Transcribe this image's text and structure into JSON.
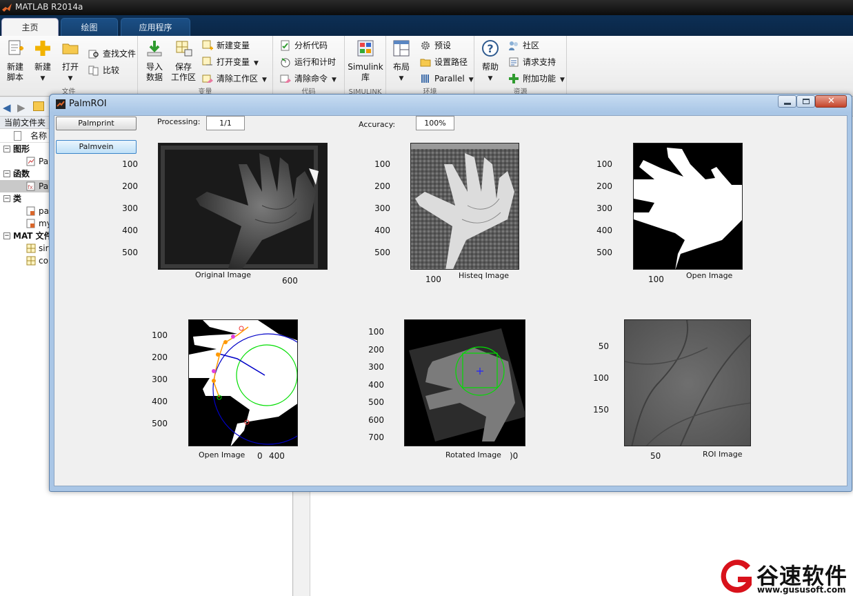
{
  "app": {
    "title": "MATLAB R2014a",
    "tabs": [
      "主页",
      "绘图",
      "应用程序"
    ],
    "active_tab": 0
  },
  "ribbon": {
    "new_script": "新建\n脚本",
    "new": "新建",
    "open": "打开",
    "find_files": "查找文件",
    "compare": "比较",
    "import_data": "导入\n数据",
    "save_workspace": "保存\n工作区",
    "new_variable": "新建变量",
    "open_variable": "打开变量",
    "clear_workspace": "清除工作区",
    "analyze_code": "分析代码",
    "run_and_time": "运行和计时",
    "clear_commands": "清除命令",
    "simulink": "Simulink\n库",
    "layout": "布局",
    "preferences": "预设",
    "set_path": "设置路径",
    "parallel": "Parallel",
    "help": "帮助",
    "community": "社区",
    "request_support": "请求支持",
    "addons": "附加功能",
    "group_labels": [
      "文件",
      "变量",
      "代码",
      "SIMULINK",
      "环境",
      "资源"
    ]
  },
  "current_folder": {
    "header": "当前文件夹",
    "column_name": "名称",
    "items": [
      {
        "label": "图形",
        "kind": "group"
      },
      {
        "label": "Pa",
        "kind": "fig"
      },
      {
        "label": "函数",
        "kind": "group"
      },
      {
        "label": "Pa",
        "kind": "func",
        "selected": true
      },
      {
        "label": "类",
        "kind": "group"
      },
      {
        "label": "pa",
        "kind": "class"
      },
      {
        "label": "my",
        "kind": "class"
      },
      {
        "label": "MAT 文件",
        "kind": "group"
      },
      {
        "label": "sir",
        "kind": "mat"
      },
      {
        "label": "co",
        "kind": "mat"
      }
    ]
  },
  "figure": {
    "title": "PalmROI",
    "buttons": {
      "palmprint": "Palmprint",
      "palmvein": "Palmvein"
    },
    "processing_label": "Processing:",
    "processing_value": "1/1",
    "accuracy_label": "Accuracy:",
    "accuracy_value": "100%",
    "axes": [
      {
        "label": "Original Image",
        "yticks": [
          "100",
          "200",
          "300",
          "400",
          "500"
        ],
        "xticks": [
          "600"
        ]
      },
      {
        "label": "Histeq Image",
        "yticks": [
          "100",
          "200",
          "300",
          "400",
          "500"
        ],
        "xticks": [
          "100"
        ]
      },
      {
        "label": "Open Image",
        "yticks": [
          "100",
          "200",
          "300",
          "400",
          "500"
        ],
        "xticks": [
          "100"
        ]
      },
      {
        "label": "Open Image",
        "yticks": [
          "100",
          "200",
          "300",
          "400",
          "500"
        ],
        "xticks": [
          "0",
          "400"
        ]
      },
      {
        "label": "Rotated Image",
        "yticks": [
          "100",
          "200",
          "300",
          "400",
          "500",
          "600",
          "700"
        ],
        "xticks": [
          ")0"
        ]
      },
      {
        "label": "ROI Image",
        "yticks": [
          "50",
          "100",
          "150"
        ],
        "xticks": [
          "50"
        ]
      }
    ]
  },
  "watermark": {
    "text": "谷速软件",
    "url": "www.gususoft.com"
  },
  "colors": {
    "ribbon_tab_bg": "#0c2f55",
    "figure_frame": "#a9c6e6",
    "roi_circle": "#00dd00",
    "contour_blue": "#0000c8"
  }
}
